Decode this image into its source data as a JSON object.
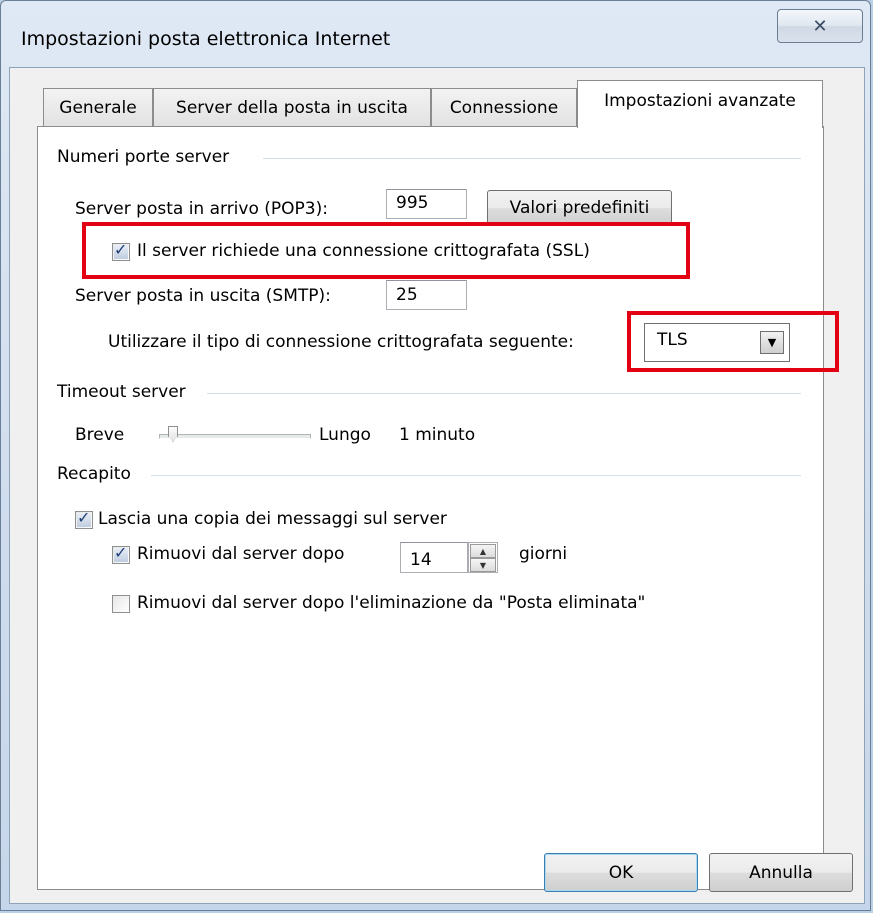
{
  "window": {
    "title": "Impostazioni posta elettronica Internet",
    "close_icon": "close-icon"
  },
  "tabs": [
    {
      "label": "Generale",
      "active": false
    },
    {
      "label": "Server della posta in uscita",
      "active": false
    },
    {
      "label": "Connessione",
      "active": false
    },
    {
      "label": "Impostazioni avanzate",
      "active": true
    }
  ],
  "ports": {
    "group_label": "Numeri porte server",
    "incoming_label": "Server posta in arrivo (POP3):",
    "incoming_value": "995",
    "defaults_button": "Valori predefiniti",
    "ssl_label": "Il server richiede una connessione crittografata (SSL)",
    "ssl_checked": true,
    "outgoing_label": "Server posta in uscita (SMTP):",
    "outgoing_value": "25",
    "encryption_label": "Utilizzare il tipo di connessione crittografata seguente:",
    "encryption_value": "TLS"
  },
  "timeout": {
    "group_label": "Timeout server",
    "short_label": "Breve",
    "long_label": "Lungo",
    "value_label": "1 minuto",
    "slider_level": 0.1
  },
  "delivery": {
    "group_label": "Recapito",
    "leave_copy_label": "Lascia una copia dei messaggi sul server",
    "leave_copy_checked": true,
    "remove_after_label": "Rimuovi dal server dopo",
    "remove_after_checked": true,
    "remove_after_days": "14",
    "days_label": "giorni",
    "remove_deleted_label": "Rimuovi dal server dopo l'eliminazione da \"Posta eliminata\"",
    "remove_deleted_checked": false
  },
  "footer": {
    "ok_label": "OK",
    "cancel_label": "Annulla"
  },
  "colors": {
    "highlight": "#e20012"
  }
}
